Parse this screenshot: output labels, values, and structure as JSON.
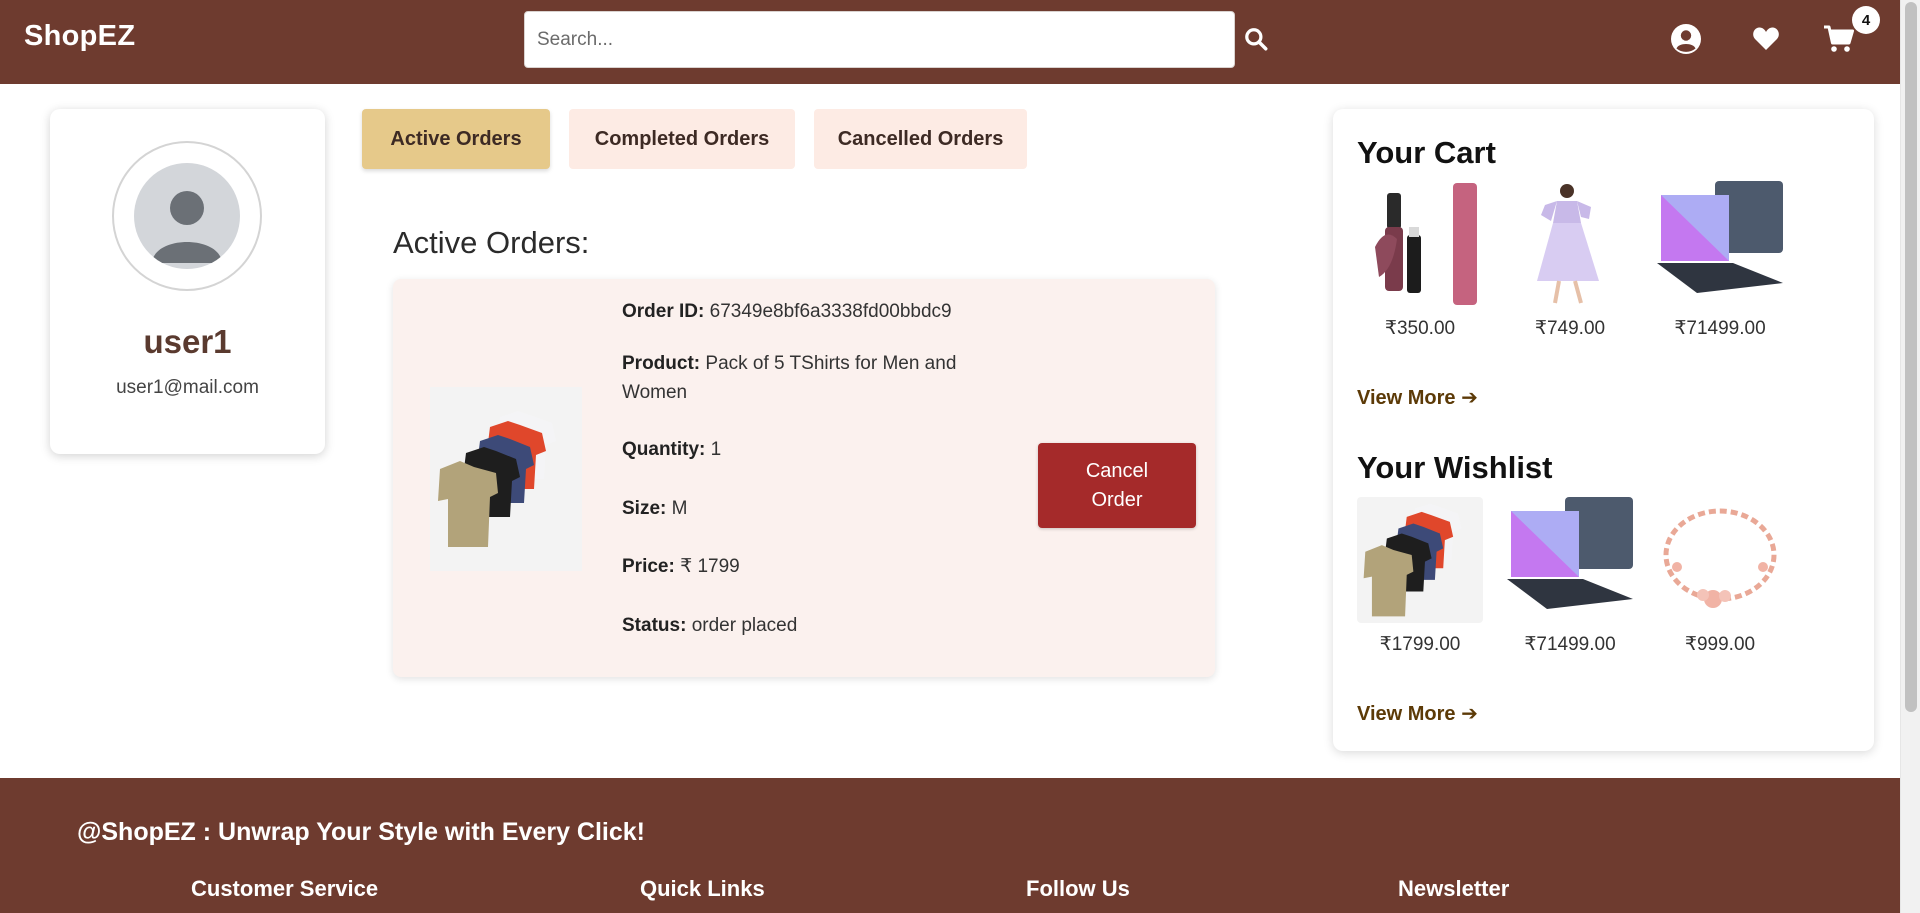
{
  "header": {
    "logo": "ShopEZ",
    "search_placeholder": "Search...",
    "cart_count": "4"
  },
  "profile": {
    "name": "user1",
    "email": "user1@mail.com"
  },
  "tabs": [
    {
      "label": "Active Orders",
      "active": true
    },
    {
      "label": "Completed Orders",
      "active": false
    },
    {
      "label": "Cancelled Orders",
      "active": false
    }
  ],
  "orders": {
    "section_title": "Active Orders:",
    "order": {
      "id_label": "Order ID:",
      "id": "67349e8bf6a3338fd00bbdc9",
      "product_label": "Product:",
      "product": "Pack of 5 TShirts for Men and Women",
      "quantity_label": "Quantity:",
      "quantity": "1",
      "size_label": "Size:",
      "size": "M",
      "price_label": "Price:",
      "price": "₹ 1799",
      "status_label": "Status:",
      "status": "order placed",
      "cancel_label": "Cancel Order"
    }
  },
  "cart": {
    "title": "Your Cart",
    "items": [
      {
        "name": "lipstick",
        "price": "₹350.00"
      },
      {
        "name": "dress",
        "price": "₹749.00"
      },
      {
        "name": "laptop",
        "price": "₹71499.00"
      }
    ],
    "view_more": "View More ➔"
  },
  "wishlist": {
    "title": "Your Wishlist",
    "items": [
      {
        "name": "tshirts",
        "price": "₹1799.00"
      },
      {
        "name": "laptop",
        "price": "₹71499.00"
      },
      {
        "name": "bracelet",
        "price": "₹999.00"
      }
    ],
    "view_more": "View More ➔"
  },
  "footer": {
    "tagline": "@ShopEZ : Unwrap Your Style with Every Click!",
    "headings": [
      "Customer Service",
      "Quick Links",
      "Follow Us",
      "Newsletter"
    ]
  },
  "colors": {
    "brand": "#6e3b2f",
    "active_tab": "#e6c98a",
    "inactive_tab": "#fdebe4",
    "cancel_button": "#a52a2a",
    "view_more": "#5c3a07"
  },
  "icons": {
    "search": "search-icon",
    "user": "user-circle-icon",
    "wishlist": "heart-icon",
    "cart": "cart-icon"
  }
}
